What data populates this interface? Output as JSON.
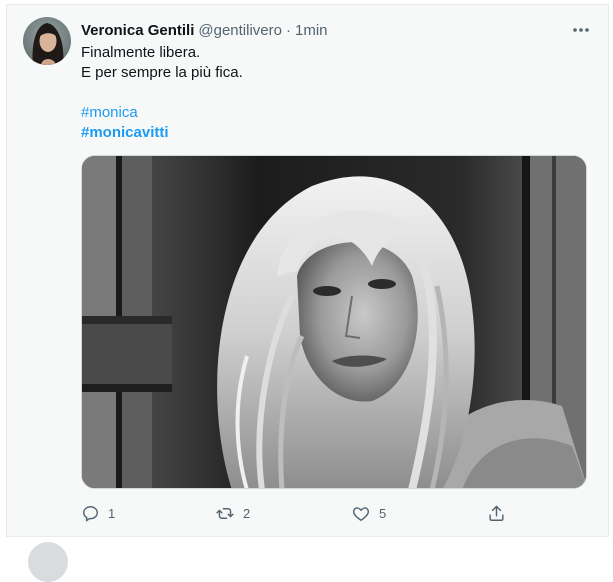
{
  "tweet": {
    "author": {
      "name": "Veronica Gentili",
      "handle": "@gentilivero",
      "separator": "·",
      "time": "1min"
    },
    "text_lines": [
      "Finalmente libera.",
      "E per sempre la più fica."
    ],
    "hashtags": [
      "#monica",
      "#monicavitti"
    ],
    "media": {
      "alt": "black and white portrait of a woman with long blonde hair"
    },
    "actions": {
      "reply_count": "1",
      "retweet_count": "2",
      "like_count": "5"
    }
  },
  "icons": [
    "more-icon",
    "reply-icon",
    "retweet-icon",
    "like-icon",
    "share-icon"
  ],
  "colors": {
    "link": "#1d9bf0",
    "secondary_text": "#536471",
    "primary_text": "#0f1419",
    "background": "#f7f9f9"
  }
}
